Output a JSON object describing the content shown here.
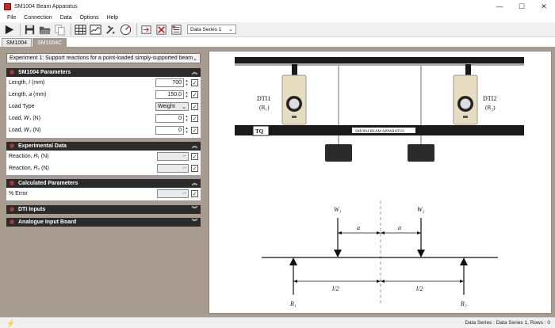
{
  "window": {
    "title": "SM1004 Beam Apparatus",
    "minimize": "—",
    "maximize": "☐",
    "close": "✕"
  },
  "menu": [
    "File",
    "Connection",
    "Data",
    "Options",
    "Help"
  ],
  "toolbar": {
    "data_series_select": "Data Series 1",
    "icons": [
      "run-icon",
      "save-icon",
      "open-folder-icon",
      "copy-icon",
      "table-icon",
      "chart-icon",
      "tools-icon",
      "gauge-icon",
      "import-icon",
      "delete-icon",
      "settings-icon"
    ]
  },
  "tabs": [
    "SM1004",
    "SM1004C"
  ],
  "experiment_select": "Experiment 1: Support reactions for a point-loaded simply-supported beam",
  "sections": {
    "parameters": {
      "title": "SM1004 Parameters",
      "rows": [
        {
          "label": "Length, 𝑙 (mm)",
          "value": "700"
        },
        {
          "label": "Length, 𝑎 (mm)",
          "value": "150.0"
        },
        {
          "label": "Load Type",
          "value": "Weight"
        },
        {
          "label": "Load, 𝑊₁ (N)",
          "value": "0"
        },
        {
          "label": "Load, 𝑊₂ (N)",
          "value": "0"
        }
      ]
    },
    "experimental": {
      "title": "Experimental Data",
      "rows": [
        {
          "label": "Reaction, 𝑅₁ (N)",
          "value": "--"
        },
        {
          "label": "Reaction, 𝑅₂ (N)",
          "value": "--"
        }
      ]
    },
    "calculated": {
      "title": "Calculated Parameters",
      "rows": [
        {
          "label": "% Error",
          "value": "--"
        }
      ]
    },
    "dti": {
      "title": "DTI Inputs"
    },
    "analogue": {
      "title": "Analogue Input Board"
    }
  },
  "apparatus": {
    "dti1": "DTI1",
    "dti1_sub": "(R₁)",
    "dti2": "DTI2",
    "dti2_sub": "(R₂)",
    "beam_label": "SM1004 BEAM APPARATUS",
    "logo": "TQ"
  },
  "diagram": {
    "w1": "W₁",
    "w2": "W₂",
    "a1": "a",
    "a2": "a",
    "l1": "l/2",
    "l2": "l/2",
    "r1": "R₁",
    "r2": "R₂"
  },
  "status": "Data Series : Data Series 1,   Rows : 0"
}
